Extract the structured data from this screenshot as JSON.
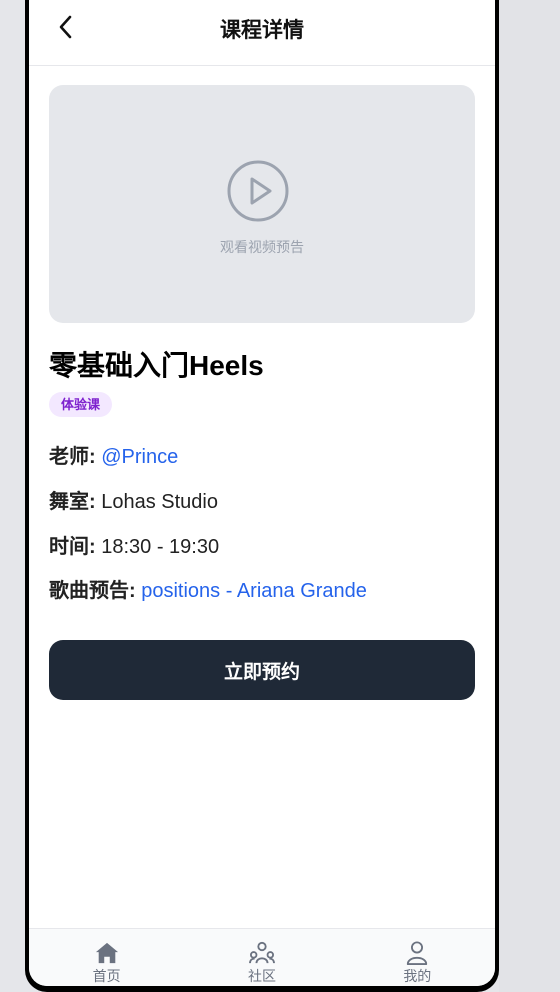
{
  "header": {
    "title": "课程详情",
    "back_icon": "chevron-left-icon"
  },
  "video": {
    "label": "观看视频预告",
    "icon": "play-circle-icon"
  },
  "course": {
    "title": "零基础入门Heels",
    "badge": "体验课",
    "teacher_label": "老师:",
    "teacher_value": "@Prince",
    "studio_label": "舞室:",
    "studio_value": "Lohas Studio",
    "time_label": "时间:",
    "time_value": "18:30 - 19:30",
    "song_label": "歌曲预告:",
    "song_value": "positions - Ariana Grande"
  },
  "cta": {
    "label": "立即预约"
  },
  "tabbar": {
    "items": [
      {
        "label": "首页",
        "icon": "home-icon"
      },
      {
        "label": "社区",
        "icon": "community-icon"
      },
      {
        "label": "我的",
        "icon": "user-icon"
      }
    ]
  },
  "colors": {
    "primary_dark": "#1f2937",
    "link": "#2563eb",
    "badge_bg": "#f3e8ff",
    "badge_text": "#7e22ce",
    "video_bg": "#e5e7eb",
    "muted": "#9ca3af"
  }
}
